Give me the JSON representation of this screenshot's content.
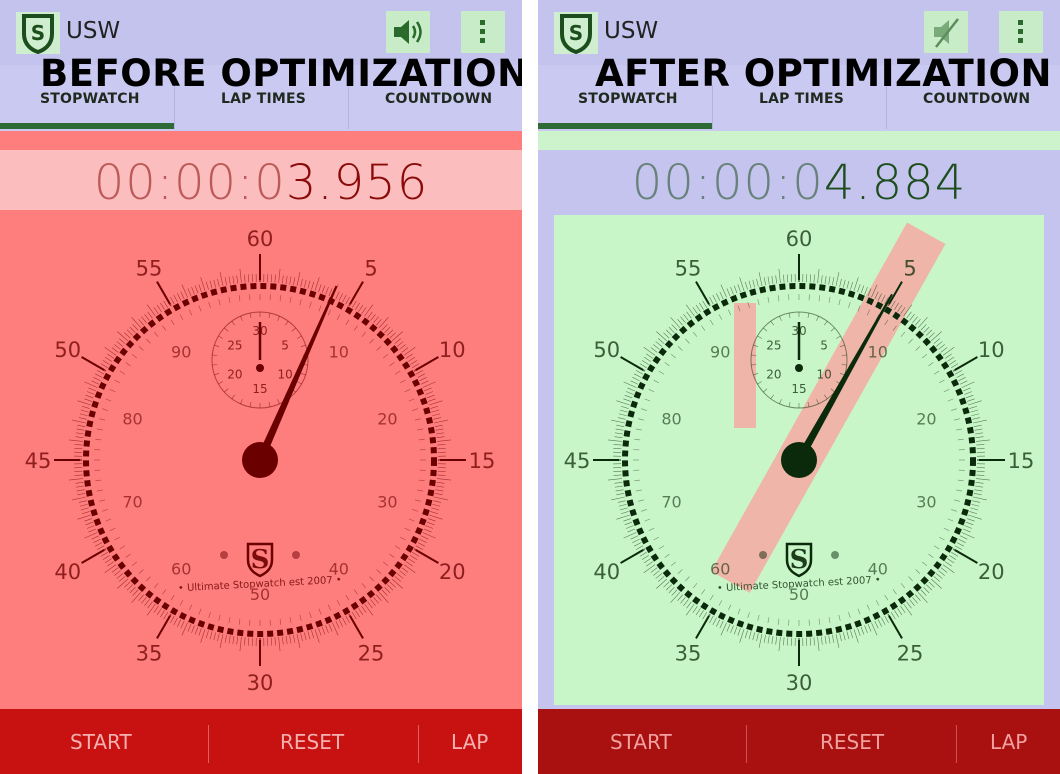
{
  "panels": {
    "before": {
      "overlay_title": "BEFORE OPTIMIZATION",
      "app_title": "USW",
      "logo": "USW-logo",
      "sound_icon": "speaker-on-icon",
      "menu_icon": "overflow-menu-icon",
      "tabs": [
        "STOPWATCH",
        "LAP TIMES",
        "COUNTDOWN"
      ],
      "active_tab": "STOPWATCH",
      "time_prefix": "00:00:0",
      "time_suffix": "3.956",
      "dial": {
        "outer_numbers": [
          "60",
          "5",
          "10",
          "15",
          "20",
          "25",
          "30",
          "35",
          "40",
          "45",
          "50",
          "55"
        ],
        "inner_numbers": [
          "10",
          "20",
          "30",
          "40",
          "50",
          "60",
          "70",
          "80",
          "90"
        ],
        "sub_numbers": [
          "30",
          "5",
          "10",
          "15",
          "20",
          "25"
        ],
        "brand_text": "Ultimate Stopwatch est 2007",
        "second_hand_value": 3.956
      },
      "buttons": [
        "START",
        "RESET",
        "LAP"
      ],
      "colors": {
        "content": "#fe7d7d",
        "accent": "#6b0000",
        "bar": "#c81212"
      }
    },
    "after": {
      "overlay_title": "AFTER OPTIMIZATION",
      "app_title": "USW",
      "logo": "USW-logo",
      "sound_icon": "speaker-muted-icon",
      "menu_icon": "overflow-menu-icon",
      "tabs": [
        "STOPWATCH",
        "LAP TIMES",
        "COUNTDOWN"
      ],
      "active_tab": "STOPWATCH",
      "time_prefix": "00:00:0",
      "time_suffix": "4.884",
      "dial": {
        "outer_numbers": [
          "60",
          "5",
          "10",
          "15",
          "20",
          "25",
          "30",
          "35",
          "40",
          "45",
          "50",
          "55"
        ],
        "inner_numbers": [
          "10",
          "20",
          "30",
          "40",
          "50",
          "60",
          "70",
          "80",
          "90"
        ],
        "sub_numbers": [
          "30",
          "5",
          "10",
          "15",
          "20",
          "25"
        ],
        "brand_text": "Ultimate Stopwatch est 2007",
        "second_hand_value": 4.884
      },
      "buttons": [
        "START",
        "RESET",
        "LAP"
      ],
      "colors": {
        "content": "#c9f6c9",
        "accent": "#0b2a0b",
        "bar": "#a91010"
      }
    }
  }
}
